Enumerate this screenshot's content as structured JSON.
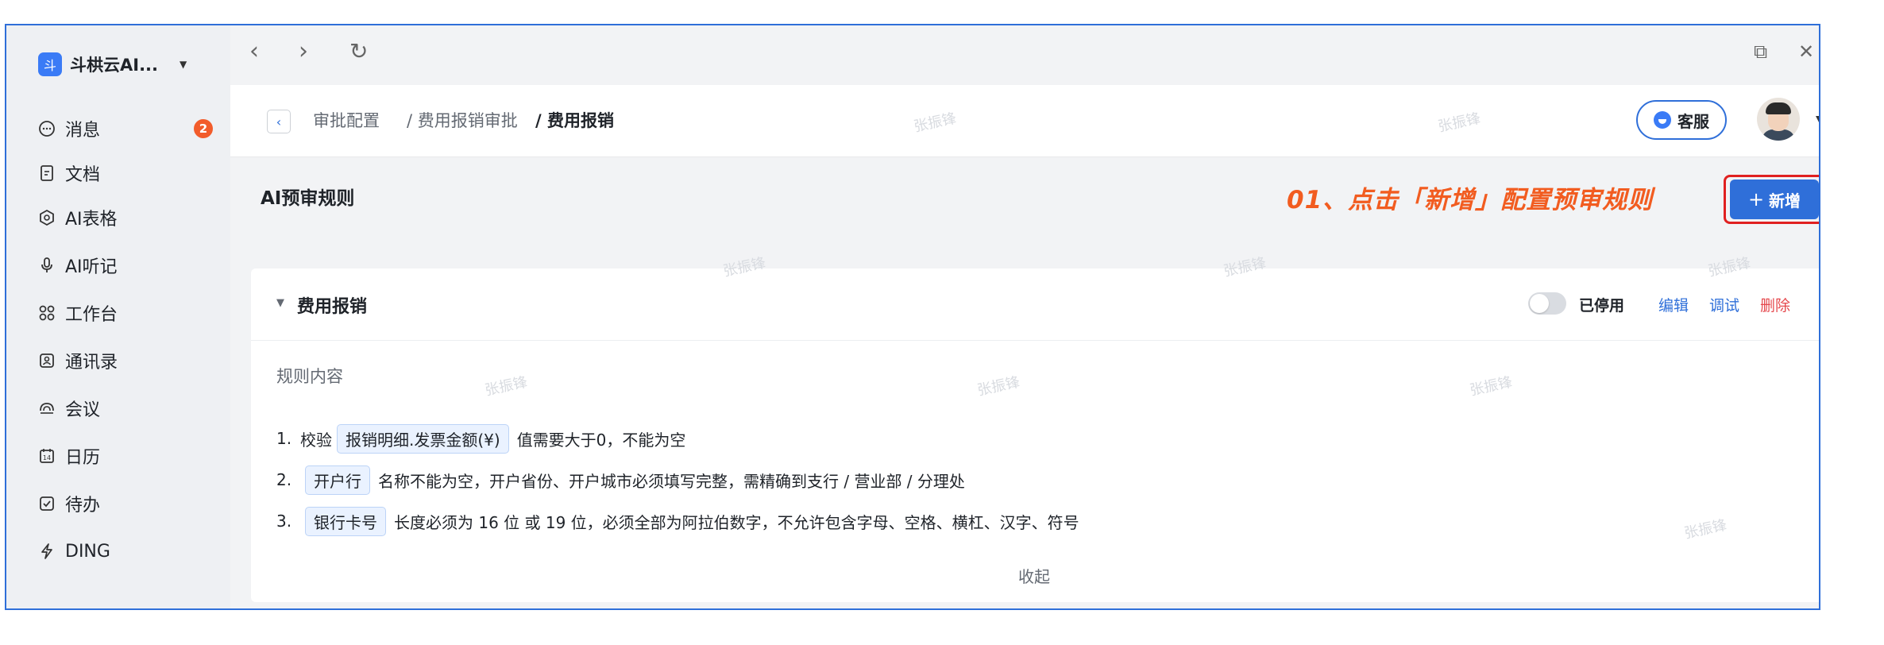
{
  "sidebar": {
    "org_logo": "斗",
    "org_name": "斗栱云AI...",
    "items": [
      {
        "label": "消息",
        "icon": "chat-icon",
        "badge": "2"
      },
      {
        "label": "文档",
        "icon": "document-icon"
      },
      {
        "label": "AI表格",
        "icon": "ai-table-icon"
      },
      {
        "label": "AI听记",
        "icon": "microphone-icon"
      },
      {
        "label": "工作台",
        "icon": "workbench-icon"
      },
      {
        "label": "通讯录",
        "icon": "contacts-icon"
      },
      {
        "label": "会议",
        "icon": "meeting-icon"
      },
      {
        "label": "日历",
        "icon": "calendar-icon"
      },
      {
        "label": "待办",
        "icon": "todo-icon"
      },
      {
        "label": "DING",
        "icon": "ding-icon"
      }
    ]
  },
  "browser": {
    "back_icon": "‹",
    "forward_icon": "›",
    "refresh_icon": "↻",
    "popout_icon": "⧉",
    "close_icon": "✕"
  },
  "breadcrumb": {
    "items": [
      "审批配置",
      "/ 费用报销审批",
      "/ 费用报销"
    ]
  },
  "header": {
    "service_label": "客服"
  },
  "toolbar": {
    "section_title": "AI预审规则",
    "annotation": "01、点击「新增」配置预审规则",
    "add_label": "新增",
    "add_icon": "+"
  },
  "rule_card": {
    "title": "费用报销",
    "status": "已停用",
    "toggle_on": false,
    "actions": {
      "edit": "编辑",
      "test": "调试",
      "delete": "删除"
    },
    "content_label": "规则内容",
    "rules": [
      {
        "num": "1.",
        "pre": "校验",
        "tag": "报销明细.发票金额(¥)",
        "text": "值需要大于0，不能为空"
      },
      {
        "num": "2.",
        "pre": "",
        "tag": "开户行",
        "text": "名称不能为空，开户省份、开户城市必须填写完整，需精确到支行 / 营业部 / 分理处"
      },
      {
        "num": "3.",
        "pre": "",
        "tag": "银行卡号",
        "text": "长度必须为 16 位 或 19 位，必须全部为阿拉伯数字，不允许包含字母、空格、横杠、汉字、符号"
      }
    ],
    "collapse_label": "收起"
  },
  "watermark": "张振锋",
  "colors": {
    "accent": "#2f6fd9",
    "annotation": "#f25c20",
    "highlight_border": "#e02020",
    "badge": "#f25c2b",
    "delete": "#e5484d"
  }
}
